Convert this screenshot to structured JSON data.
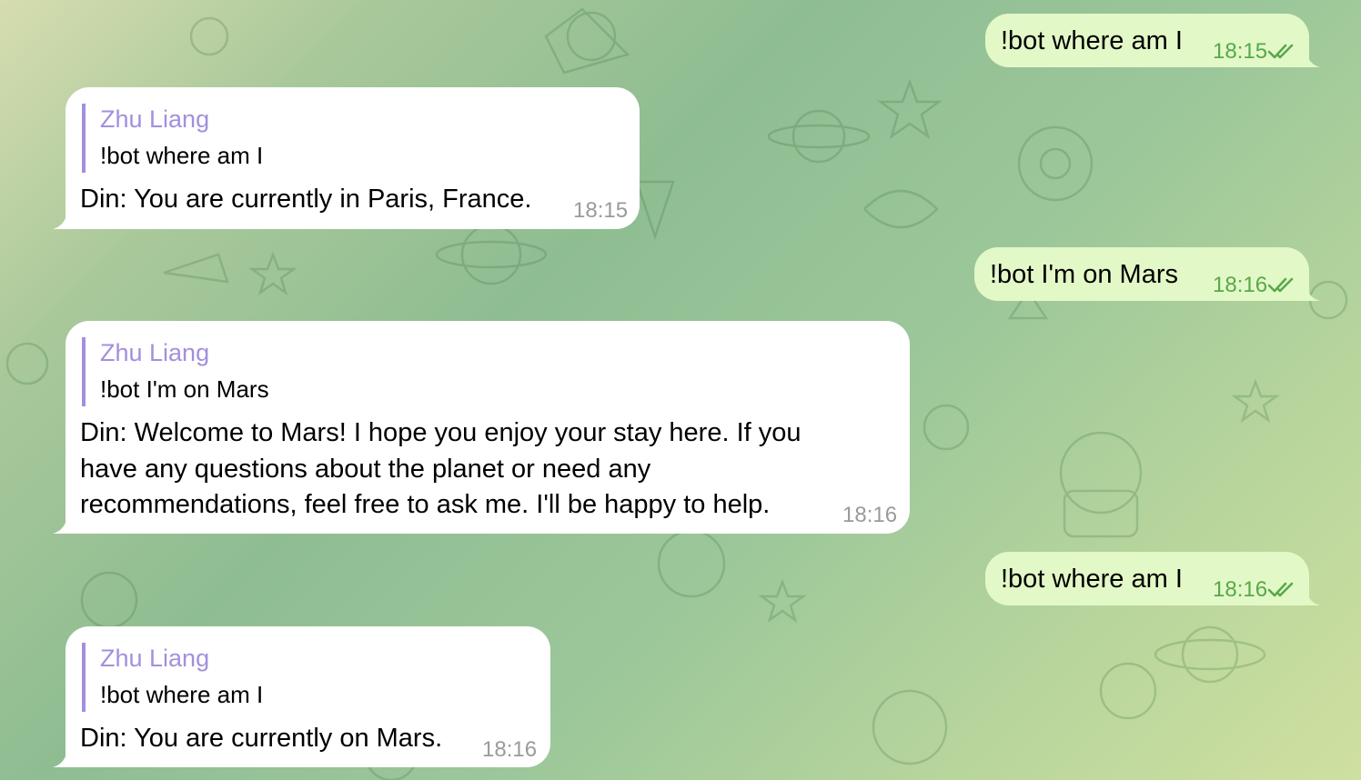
{
  "chat": {
    "colors": {
      "incoming_bubble": "#ffffff",
      "outgoing_bubble": "#e3f8c7",
      "reply_accent": "#a48fdd",
      "outgoing_time": "#57a84b",
      "incoming_time": "#9a9a9a"
    },
    "messages": [
      {
        "direction": "outgoing",
        "text": "!bot where am I",
        "time": "18:15",
        "status": "read-double-check-icon"
      },
      {
        "direction": "incoming",
        "reply_to": {
          "name": "Zhu Liang",
          "text": "!bot where am I"
        },
        "text": "Din: You are currently in Paris, France.",
        "time": "18:15"
      },
      {
        "direction": "outgoing",
        "text": "!bot I'm on Mars",
        "time": "18:16",
        "status": "read-double-check-icon"
      },
      {
        "direction": "incoming",
        "reply_to": {
          "name": "Zhu Liang",
          "text": "!bot I'm on Mars"
        },
        "text": "Din: Welcome to Mars! I hope you enjoy your stay here. If you\nhave any questions about the planet or need any\nrecommendations, feel free to ask me. I'll be happy to help.",
        "time": "18:16"
      },
      {
        "direction": "outgoing",
        "text": "!bot where am I",
        "time": "18:16",
        "status": "read-double-check-icon"
      },
      {
        "direction": "incoming",
        "reply_to": {
          "name": "Zhu Liang",
          "text": "!bot where am I"
        },
        "text": "Din: You are currently on Mars.",
        "time": "18:16"
      }
    ]
  }
}
